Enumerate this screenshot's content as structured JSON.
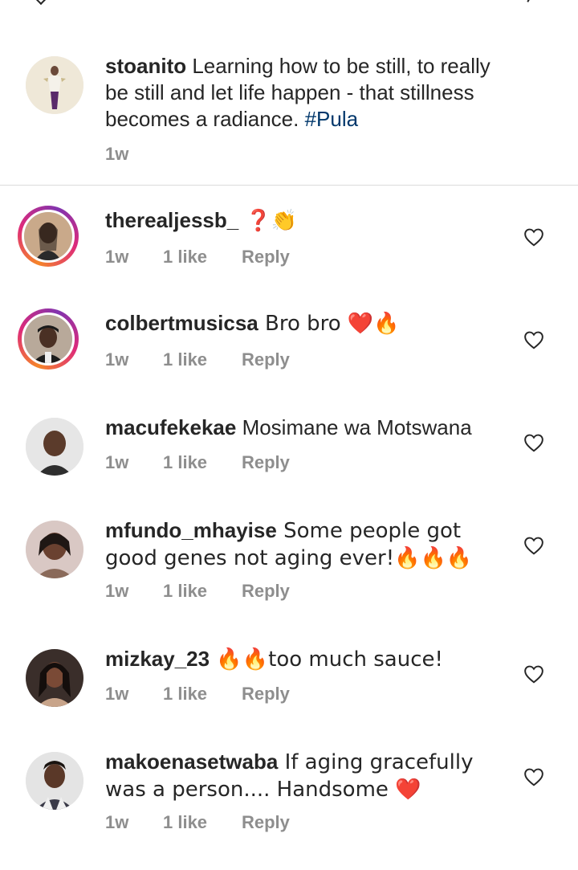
{
  "caption": {
    "username": "stoanito",
    "text": " Learning how to be still, to really be still and let life happen - that stillness becomes a radiance. ",
    "hashtag": "#Pula",
    "time": "1w"
  },
  "comments": [
    {
      "username": "therealjessb_",
      "text": " ❓👏",
      "time": "1w",
      "likes": "1 like",
      "reply": "Reply",
      "story": true
    },
    {
      "username": "colbertmusicsa",
      "text": " Bro bro ❤️🔥",
      "time": "1w",
      "likes": "1 like",
      "reply": "Reply",
      "story": true
    },
    {
      "username": "macufekekae",
      "text": " Mosimane wa Motswana",
      "time": "1w",
      "likes": "1 like",
      "reply": "Reply",
      "story": false
    },
    {
      "username": "mfundo_mhayise",
      "text": " Some people got good genes not aging ever!🔥🔥🔥",
      "time": "1w",
      "likes": "1 like",
      "reply": "Reply",
      "story": false
    },
    {
      "username": "mizkay_23",
      "text": " 🔥🔥too much sauce!",
      "time": "1w",
      "likes": "1 like",
      "reply": "Reply",
      "story": false
    },
    {
      "username": "makoenasetwaba",
      "text": " If aging gracefully was a person.... Handsome ❤️",
      "time": "1w",
      "likes": "1 like",
      "reply": "Reply",
      "story": false
    }
  ],
  "icons": {
    "like": "heart-outline-icon"
  },
  "colors": {
    "meta": "#8e8e8e",
    "hashtag": "#00376b",
    "text": "#262626",
    "divider": "#dbdbdb"
  }
}
